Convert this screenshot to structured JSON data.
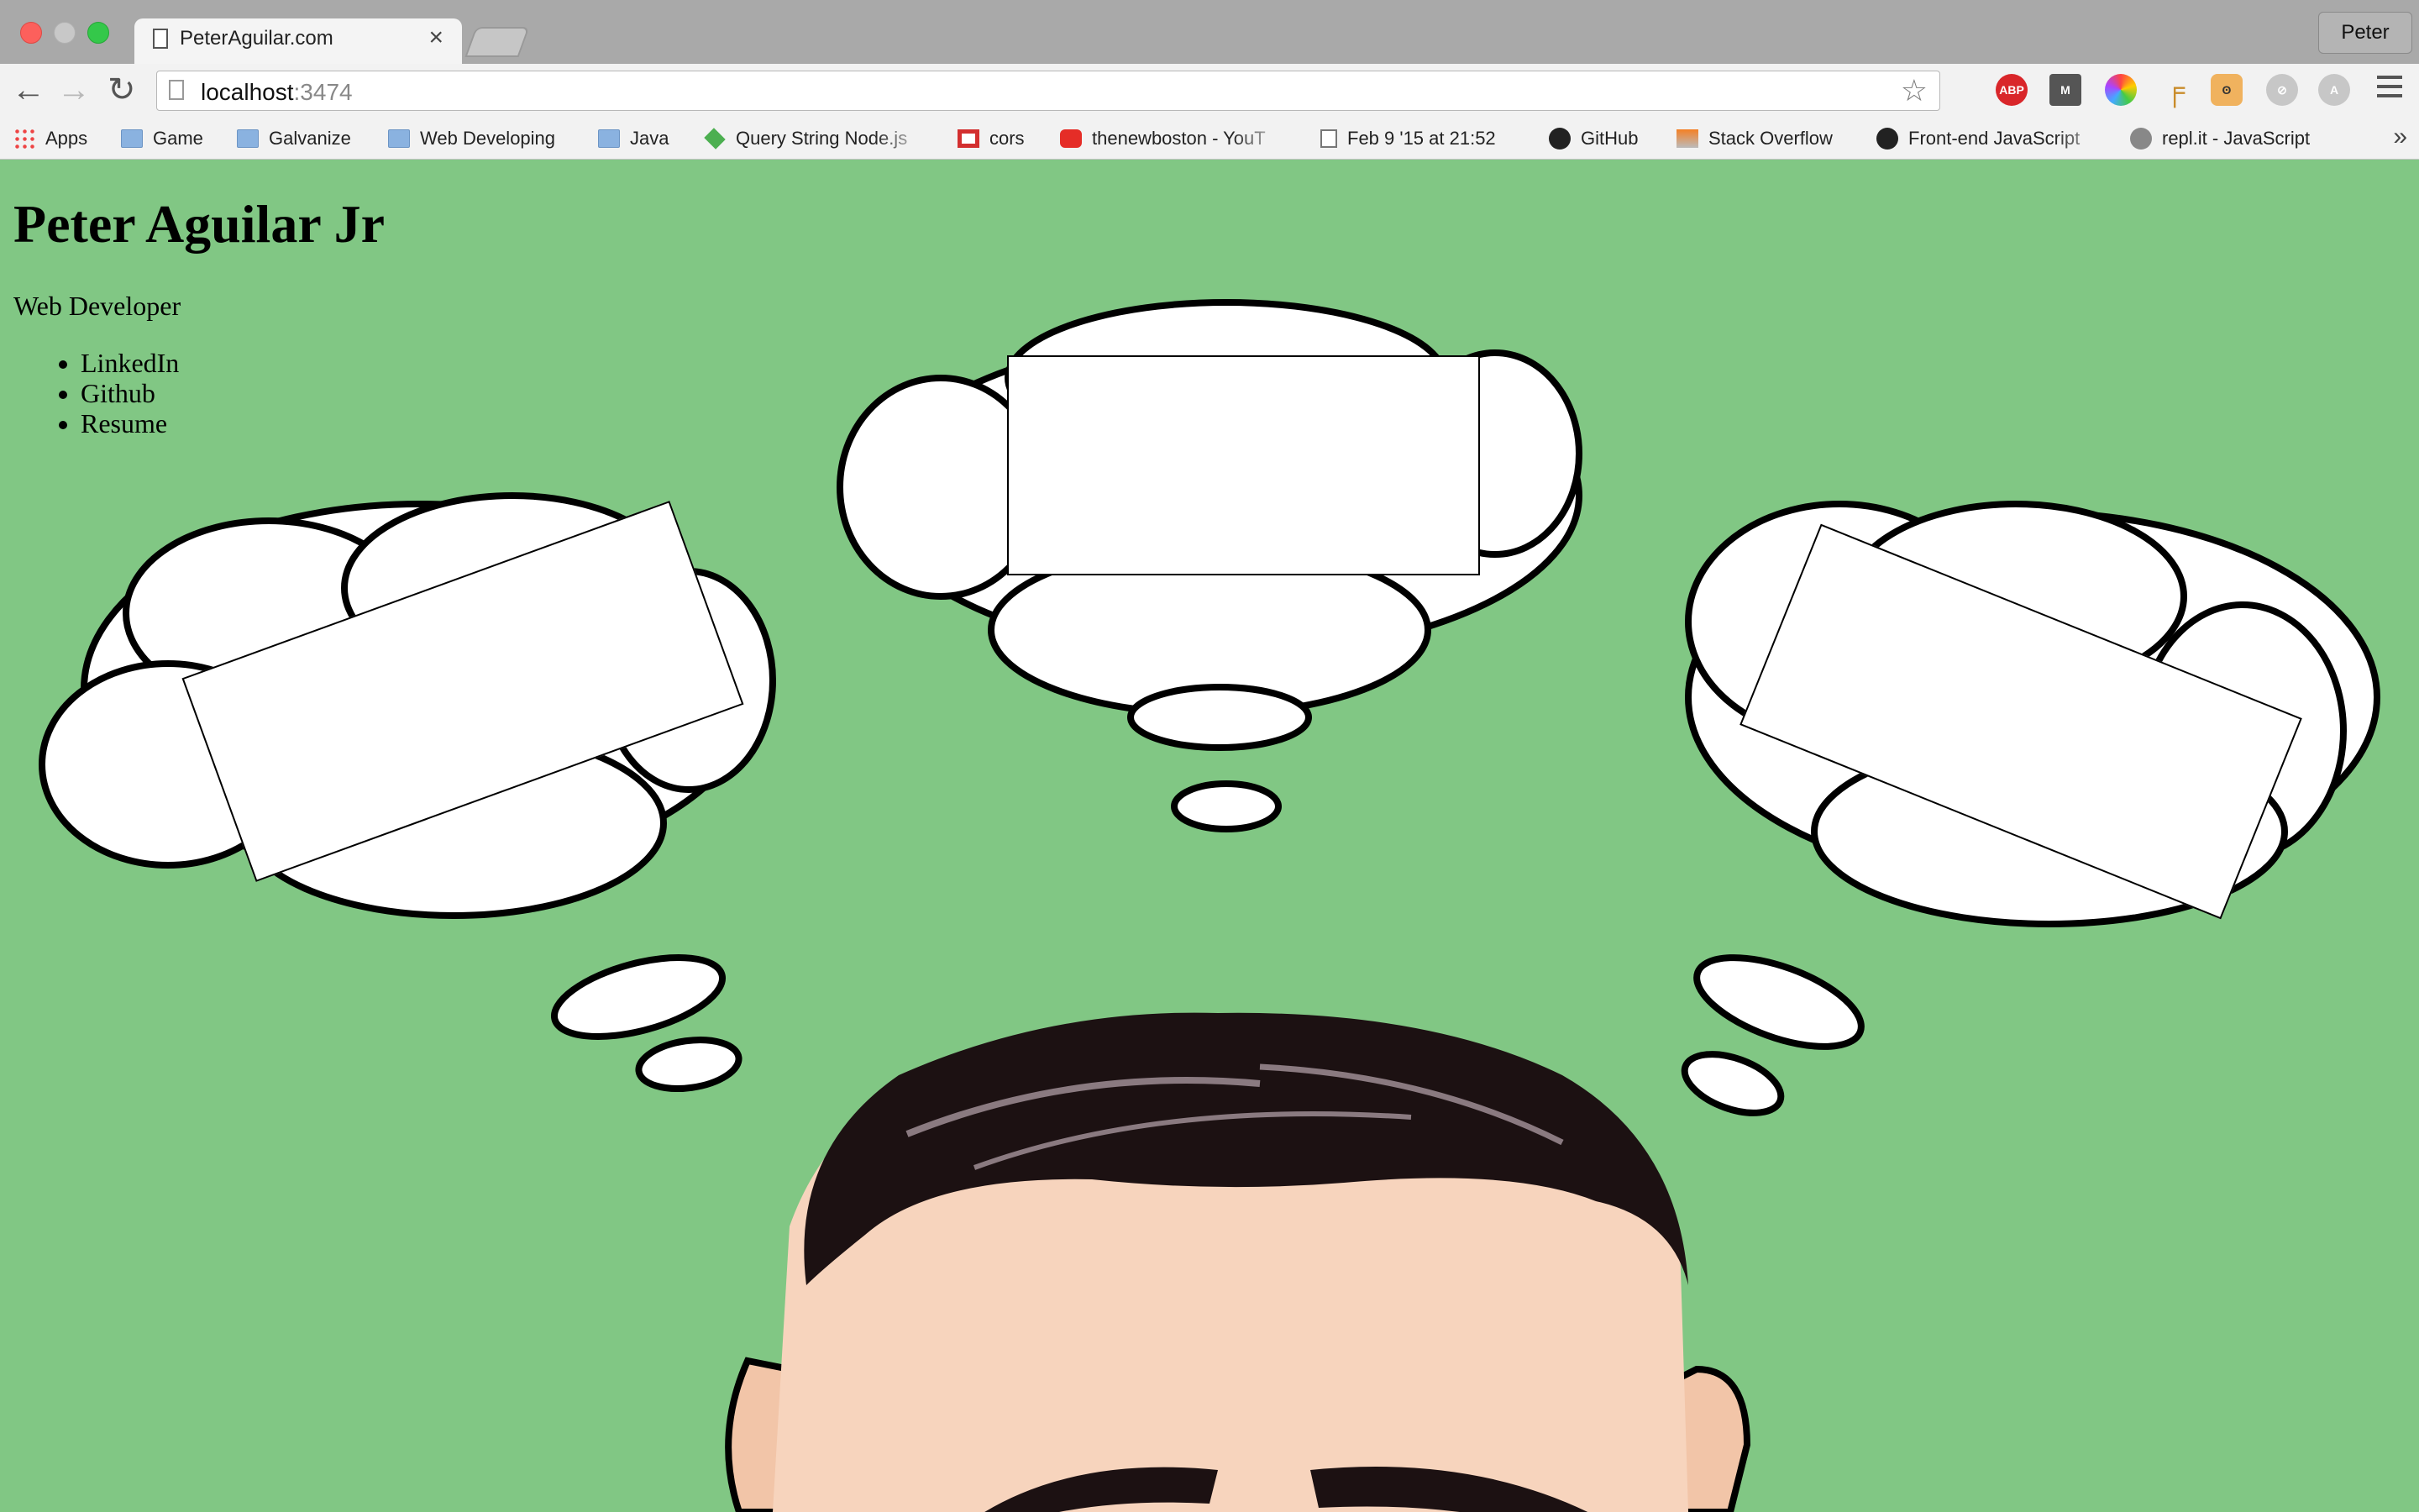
{
  "browser": {
    "tab_title": "PeterAguilar.com",
    "tab_close": "×",
    "profile": "Peter",
    "nav": {
      "back": "←",
      "forward": "→",
      "reload": "↻"
    },
    "address_host": "localhost",
    "address_port": ":3474",
    "star": "☆",
    "extensions": [
      {
        "name": "adblock-plus",
        "label": "ABP"
      },
      {
        "name": "m-extension",
        "label": "M"
      },
      {
        "name": "color-wheel",
        "label": ""
      },
      {
        "name": "pipe-tool",
        "label": "╒"
      },
      {
        "name": "face-extension",
        "label": "ʘ"
      },
      {
        "name": "compass-extension",
        "label": "⊘"
      },
      {
        "name": "a-extension",
        "label": "A"
      }
    ],
    "bookmarks": [
      {
        "label": "Apps",
        "icon": "apps-grid-icon"
      },
      {
        "label": "Game",
        "icon": "folder-icon"
      },
      {
        "label": "Galvanize",
        "icon": "folder-icon"
      },
      {
        "label": "Web Developing",
        "icon": "folder-icon"
      },
      {
        "label": "Java",
        "icon": "folder-icon"
      },
      {
        "label": "Query String Node.js",
        "icon": "nodejs-icon"
      },
      {
        "label": "cors",
        "icon": "red-box-icon"
      },
      {
        "label": "thenewboston - YouT",
        "icon": "youtube-icon"
      },
      {
        "label": "Feb 9 '15 at 21:52",
        "icon": "document-icon"
      },
      {
        "label": "GitHub",
        "icon": "github-icon"
      },
      {
        "label": "Stack Overflow",
        "icon": "stackoverflow-icon"
      },
      {
        "label": "Front-end JavaScript",
        "icon": "github-icon"
      },
      {
        "label": "repl.it - JavaScript",
        "icon": "replit-icon"
      }
    ],
    "bookmarks_overflow": "»"
  },
  "page": {
    "name": "Peter Aguilar Jr",
    "role": "Web Developer",
    "links": [
      "LinkedIn",
      "Github",
      "Resume"
    ],
    "background_color": "#81c784"
  }
}
